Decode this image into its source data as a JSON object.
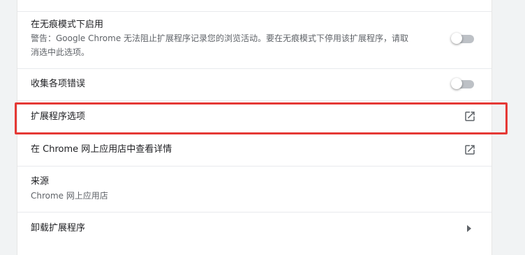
{
  "incognito": {
    "title": "在无痕模式下启用",
    "warning_line1": "警告：Google Chrome 无法阻止扩展程序记录您的浏览活动。要在无痕模式下停用该扩展程序，请取",
    "warning_line2": "消选中此选项。",
    "enabled": false
  },
  "collect_errors": {
    "title": "收集各项错误",
    "enabled": false
  },
  "extension_options": {
    "title": "扩展程序选项",
    "icon": "open-in-new-icon"
  },
  "webstore_details": {
    "title": "在 Chrome 网上应用店中查看详情",
    "icon": "open-in-new-icon"
  },
  "source": {
    "title": "来源",
    "value": "Chrome 网上应用店"
  },
  "uninstall": {
    "title": "卸载扩展程序",
    "icon": "arrow-right-icon"
  },
  "colors": {
    "highlight": "#e53935",
    "toggle_off": "#bdc1c6"
  }
}
